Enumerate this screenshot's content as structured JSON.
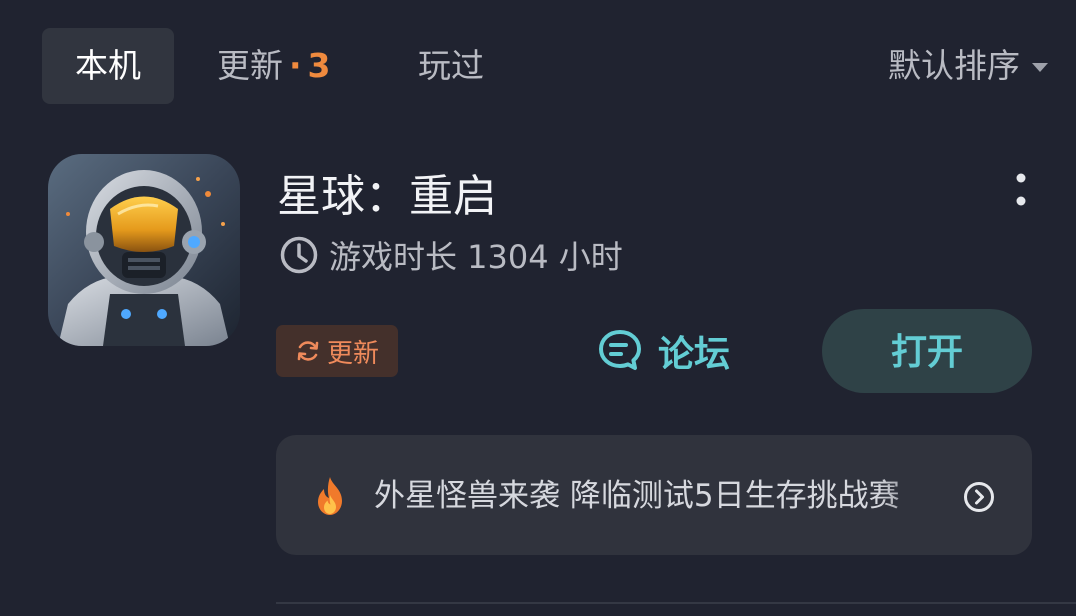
{
  "tabs": {
    "local": "本机",
    "update_label": "更新",
    "update_dot": "·",
    "update_count": "3",
    "played": "玩过"
  },
  "sort": {
    "label": "默认排序",
    "icon": "caret-down-icon"
  },
  "app": {
    "title": "星球：重启",
    "playtime": "游戏时长 1304 小时",
    "update_badge": "更新",
    "forum_label": "论坛",
    "open_label": "打开",
    "icons": {
      "clock": "clock-icon",
      "refresh": "refresh-icon",
      "forum": "chat-bubble-icon",
      "more": "more-vertical-icon"
    }
  },
  "notice": {
    "text": "外星怪兽来袭 降临测试5日生存挑战赛",
    "icons": {
      "fire": "fire-icon",
      "arrow": "chevron-right-circle-icon"
    }
  },
  "colors": {
    "background": "#202330",
    "accent_teal": "#63cdd4",
    "accent_orange": "#ef8a3e",
    "card": "#30333d"
  }
}
